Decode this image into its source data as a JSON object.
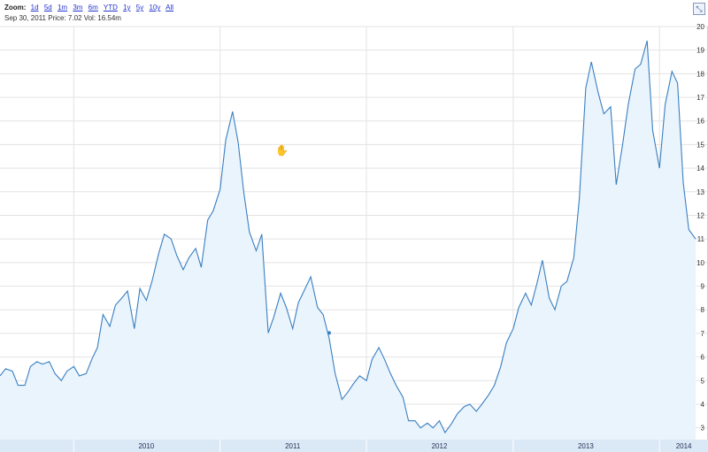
{
  "toolbar": {
    "zoom_label": "Zoom:",
    "zoom_options": [
      "1d",
      "5d",
      "1m",
      "3m",
      "6m",
      "YTD",
      "1y",
      "5y",
      "10y",
      "All"
    ],
    "readout": "Sep 30, 2011 Price: 7.02 Vol: 16.54m",
    "corner_icon": "expand-icon"
  },
  "colors": {
    "line": "#3a7fc1",
    "fill": "#eaf4fc",
    "grid": "#e3e3e3",
    "xaxis_band": "#dbe8f6",
    "xaxis_text": "#223355",
    "yaxis_text": "#333333"
  },
  "chart_data": {
    "type": "area",
    "title": "",
    "xlabel": "",
    "ylabel": "",
    "xlim": [
      "2009-07-01",
      "2014-04-01"
    ],
    "ylim": [
      2.5,
      20
    ],
    "yticks": [
      3,
      4,
      5,
      6,
      7,
      8,
      9,
      10,
      11,
      12,
      13,
      14,
      15,
      16,
      17,
      18,
      19,
      20
    ],
    "xticks": [
      {
        "label": "2010",
        "pos": "2010-01-01"
      },
      {
        "label": "2011",
        "pos": "2011-01-01"
      },
      {
        "label": "2012",
        "pos": "2012-01-01"
      },
      {
        "label": "2013",
        "pos": "2013-01-01"
      },
      {
        "label": "2014",
        "pos": "2014-01-01"
      }
    ],
    "grid": true,
    "highlight": {
      "x": "2011-09-30",
      "y": 7.02
    },
    "series": [
      {
        "x": [
          "2009-07-01",
          "2009-07-15",
          "2009-08-01",
          "2009-08-15",
          "2009-09-01",
          "2009-09-15",
          "2009-10-01",
          "2009-10-15",
          "2009-11-01",
          "2009-11-15",
          "2009-12-01",
          "2009-12-15",
          "2010-01-01",
          "2010-01-15",
          "2010-02-01",
          "2010-02-15",
          "2010-03-01",
          "2010-03-15",
          "2010-04-01",
          "2010-04-15",
          "2010-05-01",
          "2010-05-15",
          "2010-06-01",
          "2010-06-15",
          "2010-07-01",
          "2010-07-15",
          "2010-08-01",
          "2010-08-15",
          "2010-09-01",
          "2010-09-15",
          "2010-10-01",
          "2010-10-15",
          "2010-11-01",
          "2010-11-15",
          "2010-12-01",
          "2010-12-15",
          "2011-01-01",
          "2011-01-15",
          "2011-02-01",
          "2011-02-15",
          "2011-03-01",
          "2011-03-15",
          "2011-04-01",
          "2011-04-15",
          "2011-05-01",
          "2011-05-15",
          "2011-06-01",
          "2011-06-15",
          "2011-07-01",
          "2011-07-15",
          "2011-08-01",
          "2011-08-15",
          "2011-09-01",
          "2011-09-15",
          "2011-09-30",
          "2011-10-15",
          "2011-11-01",
          "2011-11-15",
          "2011-12-01",
          "2011-12-15",
          "2012-01-01",
          "2012-01-15",
          "2012-02-01",
          "2012-02-15",
          "2012-03-01",
          "2012-03-15",
          "2012-04-01",
          "2012-04-15",
          "2012-05-01",
          "2012-05-15",
          "2012-06-01",
          "2012-06-15",
          "2012-07-01",
          "2012-07-15",
          "2012-08-01",
          "2012-08-15",
          "2012-09-01",
          "2012-09-15",
          "2012-10-01",
          "2012-10-15",
          "2012-11-01",
          "2012-11-15",
          "2012-12-01",
          "2012-12-15",
          "2013-01-01",
          "2013-01-15",
          "2013-02-01",
          "2013-02-15",
          "2013-03-01",
          "2013-03-15",
          "2013-04-01",
          "2013-04-15",
          "2013-05-01",
          "2013-05-15",
          "2013-06-01",
          "2013-06-15",
          "2013-07-01",
          "2013-07-15",
          "2013-08-01",
          "2013-08-15",
          "2013-09-01",
          "2013-09-15",
          "2013-10-01",
          "2013-10-15",
          "2013-11-01",
          "2013-11-15",
          "2013-12-01",
          "2013-12-15",
          "2014-01-01",
          "2014-01-15",
          "2014-02-01",
          "2014-02-15",
          "2014-03-01",
          "2014-03-15",
          "2014-04-01"
        ],
        "values": [
          5.2,
          5.5,
          5.4,
          4.8,
          4.8,
          5.6,
          5.8,
          5.7,
          5.8,
          5.3,
          5.0,
          5.4,
          5.6,
          5.2,
          5.3,
          5.9,
          6.4,
          7.8,
          7.3,
          8.2,
          8.5,
          8.8,
          7.2,
          8.9,
          8.4,
          9.2,
          10.4,
          11.2,
          11.0,
          10.3,
          9.7,
          10.2,
          10.6,
          9.8,
          11.8,
          12.2,
          13.1,
          15.2,
          16.4,
          15.1,
          13.0,
          11.3,
          10.5,
          11.2,
          7.02,
          7.7,
          8.7,
          8.1,
          7.2,
          8.3,
          8.9,
          9.4,
          8.1,
          7.8,
          6.8,
          5.3,
          4.2,
          4.5,
          4.9,
          5.2,
          5.0,
          5.9,
          6.4,
          5.9,
          5.3,
          4.8,
          4.3,
          3.3,
          3.3,
          3.0,
          3.2,
          3.0,
          3.3,
          2.8,
          3.2,
          3.6,
          3.9,
          4.0,
          3.7,
          4.0,
          4.4,
          4.8,
          5.6,
          6.6,
          7.2,
          8.1,
          8.7,
          8.2,
          9.1,
          10.1,
          8.5,
          8.0,
          9.0,
          9.2,
          10.2,
          12.7,
          17.4,
          18.5,
          17.2,
          16.3,
          16.6,
          13.3,
          15.0,
          16.7,
          18.2,
          18.4,
          19.4,
          15.6,
          14.0,
          16.7,
          18.1,
          17.6,
          13.4,
          11.4,
          11.0
        ]
      }
    ]
  }
}
